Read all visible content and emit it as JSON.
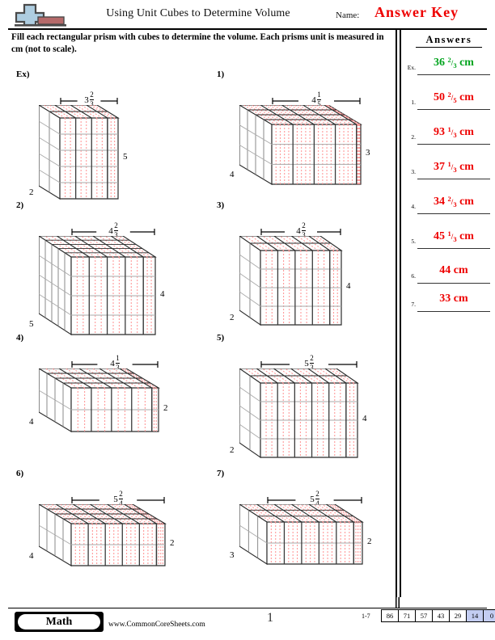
{
  "header": {
    "title": "Using Unit Cubes to Determine Volume",
    "name_label": "Name:",
    "answer_key": "Answer Key",
    "logo_icon": "plus-block-logo"
  },
  "instructions": "Fill each rectangular prism with cubes to determine the volume. Each prisms unit is measured in cm (not to scale).",
  "answers_panel": {
    "heading": "Answers",
    "rows": [
      {
        "num": "Ex.",
        "whole": "36",
        "numerator": "2",
        "denominator": "3",
        "unit": "cm",
        "color": "#00a41e"
      },
      {
        "num": "1.",
        "whole": "50",
        "numerator": "2",
        "denominator": "5",
        "unit": "cm",
        "color": "#ee0000"
      },
      {
        "num": "2.",
        "whole": "93",
        "numerator": "1",
        "denominator": "3",
        "unit": "cm",
        "color": "#ee0000"
      },
      {
        "num": "3.",
        "whole": "37",
        "numerator": "1",
        "denominator": "3",
        "unit": "cm",
        "color": "#ee0000"
      },
      {
        "num": "4.",
        "whole": "34",
        "numerator": "2",
        "denominator": "3",
        "unit": "cm",
        "color": "#ee0000"
      },
      {
        "num": "5.",
        "whole": "45",
        "numerator": "1",
        "denominator": "3",
        "unit": "cm",
        "color": "#ee0000"
      },
      {
        "num": "6.",
        "whole": "44",
        "numerator": "",
        "denominator": "",
        "unit": "cm",
        "color": "#ee0000"
      },
      {
        "num": "7.",
        "whole": "33",
        "numerator": "",
        "denominator": "",
        "unit": "cm",
        "color": "#ee0000"
      }
    ]
  },
  "problems": [
    {
      "label": "Ex)",
      "width_whole": "3",
      "width_num": "2",
      "width_den": "3",
      "height": "5",
      "depth": "2",
      "answer": "36 2/3 cm"
    },
    {
      "label": "1)",
      "width_whole": "4",
      "width_num": "1",
      "width_den": "5",
      "height": "3",
      "depth": "4",
      "answer": "50 2/5 cm"
    },
    {
      "label": "2)",
      "width_whole": "4",
      "width_num": "2",
      "width_den": "3",
      "height": "4",
      "depth": "5",
      "answer": "93 1/3 cm"
    },
    {
      "label": "3)",
      "width_whole": "4",
      "width_num": "2",
      "width_den": "3",
      "height": "4",
      "depth": "2",
      "answer": "37 1/3 cm"
    },
    {
      "label": "4)",
      "width_whole": "4",
      "width_num": "1",
      "width_den": "3",
      "height": "2",
      "depth": "4",
      "answer": "34 2/3 cm"
    },
    {
      "label": "5)",
      "width_whole": "5",
      "width_num": "2",
      "width_den": "3",
      "height": "4",
      "depth": "2",
      "answer": "45 1/3 cm"
    },
    {
      "label": "6)",
      "width_whole": "5",
      "width_num": "2",
      "width_den": "4",
      "height": "2",
      "depth": "4",
      "answer": "44 cm"
    },
    {
      "label": "7)",
      "width_whole": "5",
      "width_num": "2",
      "width_den": "4",
      "height": "2",
      "depth": "3",
      "answer": "33 cm"
    }
  ],
  "footer": {
    "subject": "Math",
    "site": "www.CommonCoreSheets.com",
    "page_number": "1",
    "score_range": "1-7",
    "score_values": [
      "86",
      "71",
      "57",
      "43",
      "29",
      "14",
      "0"
    ],
    "highlighted_scores": [
      "14",
      "0"
    ]
  },
  "colors": {
    "answer_red": "#ee0000",
    "example_green": "#00a41e",
    "grid_red": "#ff9a9a",
    "score_highlight": "#c3cdf2",
    "logo_blue": "#aecde0",
    "logo_red": "#b56a6a"
  }
}
